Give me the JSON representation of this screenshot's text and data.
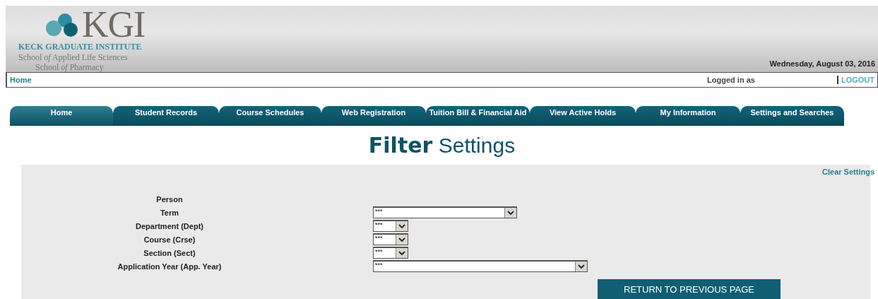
{
  "header": {
    "logo_text": "KGI",
    "institute": "KECK GRADUATE INSTITUTE",
    "schools": [
      "School *of* Applied Life Sciences",
      "School *of* Pharmacy"
    ],
    "date": "Wednesday, August 03, 2016"
  },
  "breadcrumb": {
    "path": "Home",
    "logged_in_label": "Logged in as",
    "logout": "LOGOUT"
  },
  "tabs": [
    {
      "label": "Home",
      "selected": true
    },
    {
      "label": "Student Records",
      "selected": false
    },
    {
      "label": "Course Schedules",
      "selected": false
    },
    {
      "label": "Web Registration",
      "selected": false
    },
    {
      "label": "Tuition Bill & Financial Aid",
      "selected": false
    },
    {
      "label": "View Active Holds",
      "selected": false
    },
    {
      "label": "My Information",
      "selected": false
    },
    {
      "label": "Settings and Searches",
      "selected": false
    }
  ],
  "title": {
    "bold": "Filter",
    "rest": "Settings"
  },
  "clear_link": "Clear Settings",
  "fields": [
    {
      "label": "Person",
      "kind": "text"
    },
    {
      "label": "Term",
      "kind": "select",
      "value": "***"
    },
    {
      "label": "Department (Dept)",
      "kind": "select",
      "value": "***"
    },
    {
      "label": "Course (Crse)",
      "kind": "select",
      "value": "***"
    },
    {
      "label": "Section (Sect)",
      "kind": "select",
      "value": "***"
    },
    {
      "label": "Application Year (App. Year)",
      "kind": "select",
      "value": "***"
    }
  ],
  "return_button": "RETURN TO PREVIOUS PAGE"
}
